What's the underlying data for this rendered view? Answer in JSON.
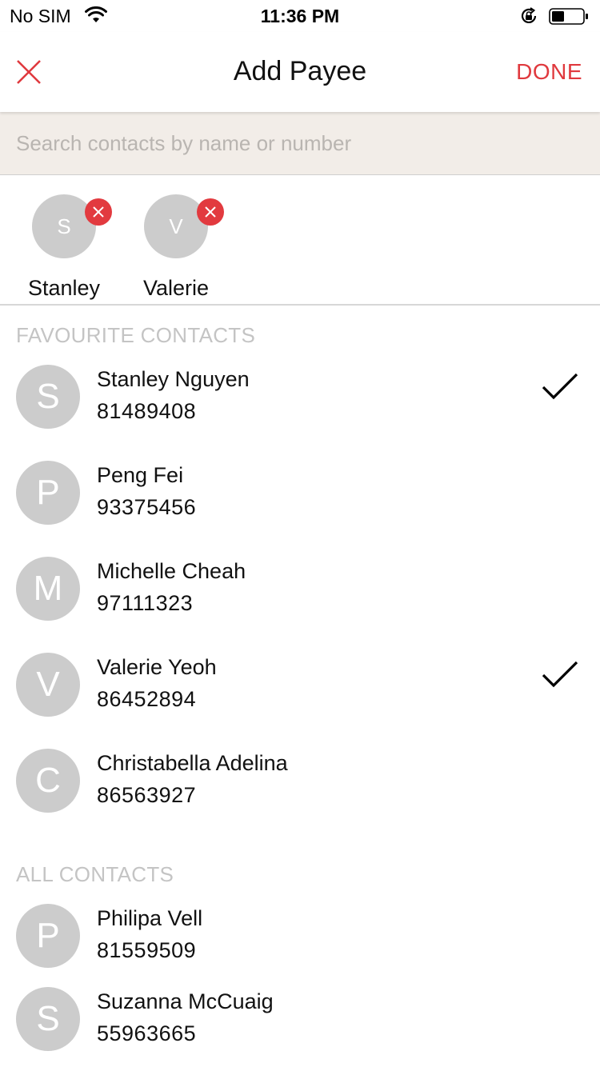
{
  "status_bar": {
    "carrier": "No SIM",
    "time": "11:36 PM"
  },
  "nav": {
    "title": "Add Payee",
    "done_label": "DONE"
  },
  "search": {
    "placeholder": "Search contacts by name or number",
    "value": ""
  },
  "selected": [
    {
      "initial": "S",
      "name": "Stanley"
    },
    {
      "initial": "V",
      "name": "Valerie"
    }
  ],
  "favourites": {
    "header": "FAVOURITE CONTACTS",
    "contacts": [
      {
        "initial": "S",
        "name": "Stanley Nguyen",
        "phone": "81489408",
        "selected": true
      },
      {
        "initial": "P",
        "name": "Peng Fei",
        "phone": "93375456",
        "selected": false
      },
      {
        "initial": "M",
        "name": "Michelle Cheah",
        "phone": "97111323",
        "selected": false
      },
      {
        "initial": "V",
        "name": "Valerie Yeoh",
        "phone": "86452894",
        "selected": true
      },
      {
        "initial": "C",
        "name": "Christabella Adelina",
        "phone": "86563927",
        "selected": false
      }
    ]
  },
  "all_contacts": {
    "header": "ALL CONTACTS",
    "contacts": [
      {
        "initial": "P",
        "name": "Philipa Vell",
        "phone": "81559509",
        "selected": false
      },
      {
        "initial": "S",
        "name": "Suzanna McCuaig",
        "phone": "55963665",
        "selected": false
      }
    ]
  },
  "colors": {
    "accent": "#e0393e",
    "avatar": "#cccccc",
    "search_bg": "#f2ede8",
    "section_header": "#c4c4c4"
  },
  "icons": [
    "wifi-icon",
    "lock-rotation-icon",
    "battery-icon",
    "close-icon",
    "remove-icon",
    "checkmark-icon"
  ]
}
